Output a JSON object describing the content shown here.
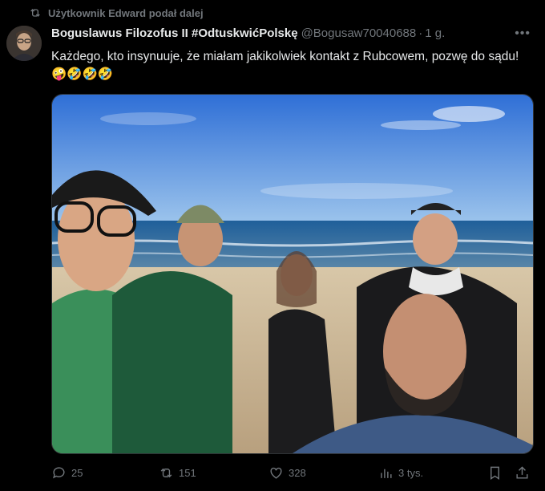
{
  "repost": {
    "text": "Użytkownik Edward podał dalej"
  },
  "author": {
    "name": "Boguslawus Filozofus II #OdtuskwićPolskę",
    "handle": "@Bogusaw70040688",
    "separator": "·",
    "time": "1 g."
  },
  "tweet": {
    "text": "Każdego, kto insynuuje, że miałam jakikolwiek kontakt z Rubcowem, pozwę do sądu!",
    "emojis": "🤪🤣🤣🤣"
  },
  "stats": {
    "replies": "25",
    "reposts": "151",
    "likes": "328",
    "views": "3 tys."
  },
  "colors": {
    "background": "#000000",
    "text": "#e7e9ea",
    "muted": "#71767b",
    "border": "#2f3336"
  }
}
